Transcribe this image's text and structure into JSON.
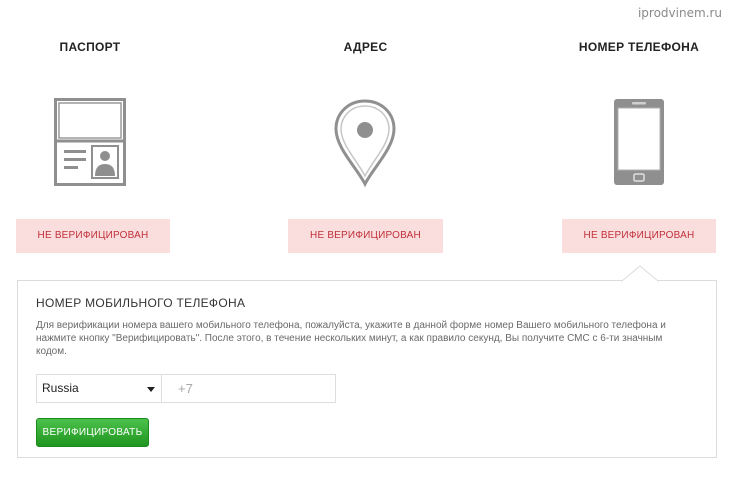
{
  "watermark": "iprodvinem.ru",
  "columns": [
    {
      "title": "ПАСПОРТ",
      "icon": "passport-icon",
      "status": "НЕ ВЕРИФИЦИРОВАН"
    },
    {
      "title": "АДРЕС",
      "icon": "map-pin-icon",
      "status": "НЕ ВЕРИФИЦИРОВАН"
    },
    {
      "title": "НОМЕР ТЕЛЕФОНА",
      "icon": "mobile-phone-icon",
      "status": "НЕ ВЕРИФИЦИРОВАН"
    }
  ],
  "panel": {
    "title": "НОМЕР МОБИЛЬНОГО ТЕЛЕФОНА",
    "description": "Для верификации номера вашего мобильного телефона, пожалуйста, укажите в данной форме номер Вашего мобильного телефона и нажмите кнопку \"Верифицировать\". После этого, в течение нескольких минут, а как правило секунд, Вы получите СМС с 6-ти значным кодом.",
    "country": "Russia",
    "phone_placeholder": "+7",
    "phone_value": "",
    "verify_label": "ВЕРИФИЦИРОВАТЬ"
  },
  "colors": {
    "status_bg": "#fadede",
    "status_text": "#c0303a",
    "button_green": "#2aa52a",
    "icon_gray": "#8f8f8f"
  }
}
